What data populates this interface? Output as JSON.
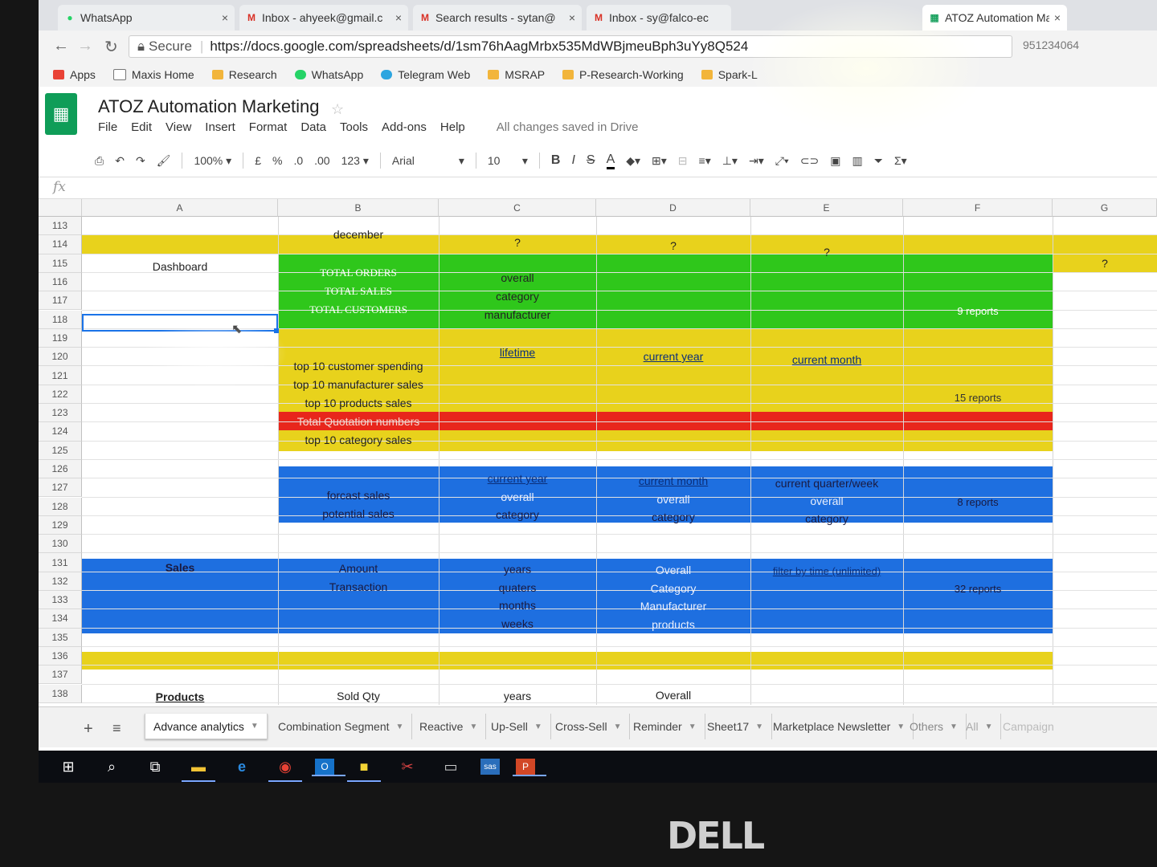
{
  "browser": {
    "tabs": [
      {
        "label": "WhatsApp",
        "icon": "whatsapp-icon",
        "color": "#25d366"
      },
      {
        "label": "Inbox - ahyeek@gmail.c",
        "icon": "gmail-icon",
        "color": "#d93025"
      },
      {
        "label": "Search results - sytan@",
        "icon": "gmail-icon",
        "color": "#d93025"
      },
      {
        "label": "Inbox - sy@falco-ec",
        "icon": "gmail-icon",
        "color": "#d93025"
      },
      {
        "label": "ATOZ Automation Mark",
        "icon": "sheets-icon",
        "color": "#0f9d58"
      }
    ],
    "tab_close": "×",
    "secure_label": "Secure",
    "url": "https://docs.google.com/spreadsheets/d/1sm76hAagMrbx535MdWBjmeuBph3uYy8Q524",
    "right_text": "951234064",
    "bookmarks": [
      {
        "label": "Apps",
        "color": "#e94235"
      },
      {
        "label": "Maxis Home",
        "color": "#ffffff"
      },
      {
        "label": "Research",
        "color": "#f2b53b"
      },
      {
        "label": "WhatsApp",
        "color": "#25d366"
      },
      {
        "label": "Telegram Web",
        "color": "#2ca5e0"
      },
      {
        "label": "MSRAP",
        "color": "#f2b53b"
      },
      {
        "label": "P-Research-Working",
        "color": "#f2b53b"
      },
      {
        "label": "Spark-L",
        "color": "#f2b53b"
      }
    ]
  },
  "sheets": {
    "title": "ATOZ Automation Marketing",
    "menu": [
      "File",
      "Edit",
      "View",
      "Insert",
      "Format",
      "Data",
      "Tools",
      "Add-ons",
      "Help"
    ],
    "saved_status": "All changes saved in Drive",
    "toolbar": {
      "zoom": "100%",
      "currency": "£",
      "percent": "%",
      "dec_less": ".0",
      "dec_more": ".00",
      "format_more": "123",
      "font": "Arial",
      "font_size": "10",
      "bold": "B",
      "italic": "I",
      "strike": "S",
      "text_color": "A"
    },
    "formula_label": "fx"
  },
  "grid": {
    "columns": [
      "A",
      "B",
      "C",
      "D",
      "E",
      "F",
      "G"
    ],
    "rows": [
      "113",
      "114",
      "115",
      "116",
      "117",
      "118",
      "119",
      "120",
      "121",
      "122",
      "123",
      "124",
      "125",
      "126",
      "127",
      "128",
      "129",
      "130",
      "131",
      "132",
      "133",
      "134",
      "135",
      "136",
      "137",
      "138"
    ],
    "cells": {
      "b113": "december",
      "c114": "?",
      "d114": "?",
      "e114": "?",
      "g115": "?",
      "a115": "Dashboard",
      "b116": "TOTAL ORDERS",
      "b117": "TOTAL SALES",
      "b118": "TOTAL CUSTOMERS",
      "c116": "overall",
      "c117": "category",
      "c118": "manufacturer",
      "f117": "9 reports",
      "c120": "lifetime",
      "d120": "current year",
      "e120": "current month",
      "b120": "top 10 customer spending",
      "b121": "top 10 manufacturer sales",
      "b122": "top 10 products sales",
      "f122": "15 reports",
      "b123": "Total Quotation numbers",
      "b124": "top 10 category sales",
      "c126": "current year",
      "d126": "current month",
      "e126": "current quarter/week",
      "b127": "forcast sales",
      "c127": "overall",
      "d127": "overall",
      "e127": "overall",
      "f127": "8 reports",
      "b128": "potential sales",
      "c128": "category",
      "d128": "category",
      "e128": "category",
      "a131": "Sales",
      "b131": "Amount",
      "c131": "years",
      "d131": "Overall",
      "e131": "filter by time (unlimited)",
      "b132": "Transaction",
      "c132": "quaters",
      "d132": "Category",
      "f132": "32 reports",
      "c133": "months",
      "d133": "Manufacturer",
      "c134": "weeks",
      "d134": "products",
      "a138": "Products",
      "b138": "Sold Qty",
      "c138": "years",
      "d138": "Overall"
    },
    "colors": {
      "yellow": "#e8d21c",
      "green": "#2fc71b",
      "red": "#e8261c",
      "blue": "#1e6fe0"
    }
  },
  "sheet_tabs": [
    {
      "label": "Advance analytics",
      "active": true
    },
    {
      "label": "Combination Segment",
      "active": false
    },
    {
      "label": "Reactive",
      "active": false
    },
    {
      "label": "Up-Sell",
      "active": false
    },
    {
      "label": "Cross-Sell",
      "active": false
    },
    {
      "label": "Reminder",
      "active": false
    },
    {
      "label": "Sheet17",
      "active": false
    },
    {
      "label": "Marketplace Newsletter",
      "active": false
    },
    {
      "label": "Others",
      "active": false
    },
    {
      "label": "All",
      "active": false
    },
    {
      "label": "Campaign",
      "active": false
    }
  ],
  "taskbar": {
    "icons": [
      "windows-start-icon",
      "search-icon",
      "task-view-icon",
      "file-explorer-icon",
      "edge-icon",
      "chrome-icon",
      "outlook-icon",
      "sticky-notes-icon",
      "snipping-tool-icon",
      "terminal-icon",
      "sas-icon",
      "powerpoint-icon"
    ],
    "sas_label": "sas",
    "outlook_label": "O",
    "powerpoint_label": "P"
  },
  "monitor_brand": "DELL"
}
